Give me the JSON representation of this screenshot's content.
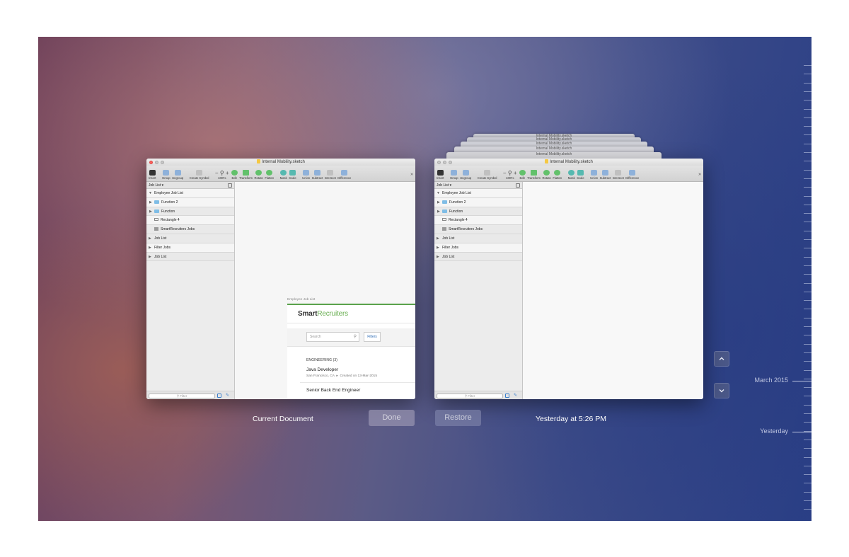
{
  "window_title": "Internal Mobility.sketch",
  "stack_titles": [
    "Internal Mobility.sketch",
    "Internal Mobility.sketch",
    "Internal Mobility.sketch",
    "Internal Mobility.sketch",
    "Internal Mobility.sketch"
  ],
  "toolbar": {
    "insert": "Insert",
    "group": "Group",
    "ungroup": "Ungroup",
    "create_symbol": "Create Symbol",
    "zoom_minus": "−",
    "zoom_plus": "+",
    "zoom_value": "100%",
    "edit": "Edit",
    "transform": "Transform",
    "rotate": "Rotate",
    "flatten": "Flatten",
    "mask": "Mask",
    "scale": "Scale",
    "union": "Union",
    "subtract": "Subtract",
    "intersect": "Intersect",
    "difference": "Difference",
    "more": "»"
  },
  "sidebar": {
    "page_selector": "Job List ▾",
    "layers": [
      {
        "label": "Employee Job List",
        "indent": 0,
        "marker": "▼",
        "icon": "none"
      },
      {
        "label": "Function 2",
        "indent": 1,
        "marker": "▶",
        "icon": "folder-icon"
      },
      {
        "label": "Function",
        "indent": 1,
        "marker": "▶",
        "icon": "folder-icon"
      },
      {
        "label": "Rectangle 4",
        "indent": 1,
        "marker": "",
        "icon": "rectangle-icon"
      },
      {
        "label": "SmartRecruiters   Jobs",
        "indent": 1,
        "marker": "",
        "icon": "image-icon"
      },
      {
        "label": "Job List",
        "indent": 0,
        "marker": "▶",
        "icon": "none"
      },
      {
        "label": "Filter Jobs",
        "indent": 0,
        "marker": "▶",
        "icon": "none"
      },
      {
        "label": "Job List",
        "indent": 0,
        "marker": "▶",
        "icon": "none"
      }
    ],
    "filter_placeholder": "Filter"
  },
  "artboard": {
    "label": "Employee Job List",
    "logo_bold": "Smart",
    "logo_light": "Recruiters",
    "search_placeholder": "Search",
    "filters_button": "Filters",
    "section": "ENGINEERING (3)",
    "jobs": [
      {
        "title": "Java Developer",
        "location": "San Francisco, CA",
        "created": "Created on 13-Mar-2015"
      },
      {
        "title": "Senior Back End Engineer",
        "location": "",
        "created": ""
      }
    ]
  },
  "captions": {
    "current": "Current Document",
    "done": "Done",
    "restore": "Restore",
    "version_time": "Yesterday at 5:26 PM"
  },
  "timeline": {
    "labels": [
      "March 2015",
      "Yesterday"
    ]
  },
  "colors": {
    "accent_green": "#5aa24b",
    "close_red": "#fc605c",
    "folder_blue": "#7fbde6"
  }
}
